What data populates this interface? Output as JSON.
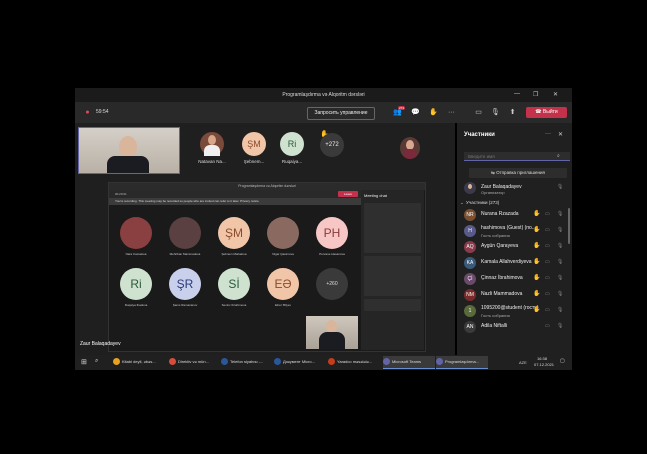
{
  "window": {
    "title": "Programlaşdırma və Alqoritm dərsləri"
  },
  "toolbar": {
    "timer": "59:54",
    "share_label": "Запросить управление",
    "leave_label": "Выйти",
    "people_badge": "273"
  },
  "top_tiles": [
    {
      "initials": "",
      "name": "Natavan Na...",
      "color": "#7a4a3a",
      "photo": true
    },
    {
      "initials": "ŞM",
      "name": "Şebnem...",
      "color": "#f0c5a8",
      "photo": false
    },
    {
      "initials": "Ri",
      "name": "Ruqaiya...",
      "color": "#cfe2d0",
      "photo": false
    },
    {
      "initials": "+272",
      "name": "",
      "color": "#3a3a3a",
      "photo": false
    }
  ],
  "presenter_name": "Zaur Balaqadayev",
  "shared": {
    "title": "Programlaşdırma və Alqoritm dərsləri",
    "banner": "You're recording. This meeting may be recorded so people who are invited can refer to it later. Privacy notice",
    "timer": "00:20:01",
    "leave": "Leave",
    "chat_title": "Meeting chat",
    "tiles": [
      {
        "initials": "",
        "name": "Nara Camalova",
        "color": "#8a4040",
        "photo": true
      },
      {
        "initials": "",
        "name": "Mehriban Mammadova",
        "color": "#5a4040",
        "photo": true
      },
      {
        "initials": "ŞM",
        "name": "Şebnem Mahalova",
        "color": "#f0c5a8",
        "photo": false
      },
      {
        "initials": "",
        "name": "Nigar Qasimova",
        "color": "#8a6a60",
        "photo": true
      },
      {
        "initials": "PH",
        "name": "Pervane Hasanova",
        "color": "#f6c7c5",
        "photo": false
      },
      {
        "initials": "Ri",
        "name": "Ruqaiya Ibadova",
        "color": "#cfe2d0",
        "photo": false
      },
      {
        "initials": "ŞR",
        "name": "Şams Ramazanov",
        "color": "#c8d0ec",
        "photo": false
      },
      {
        "initials": "Sİ",
        "name": "Sevinc Ibrahimova",
        "color": "#cfe2d0",
        "photo": false
      },
      {
        "initials": "EƏ",
        "name": "Elnur Əliyev",
        "color": "#f0c5a8",
        "photo": false
      },
      {
        "initials": "+260",
        "name": "",
        "color": "#3a3a3a",
        "photo": false
      }
    ]
  },
  "panel": {
    "title": "Участники",
    "search_placeholder": "Введите имя",
    "invite_label": "Отправка приглашения",
    "organizer": {
      "name": "Zaur Balaqadayev",
      "role": "Организатор"
    },
    "attendees_header": "Участники (273)",
    "attendees": [
      {
        "name": "Nurana Rzazada",
        "sub": "",
        "initials": "NR",
        "color": "#7a5030",
        "hand": true
      },
      {
        "name": "hashimova (Guest) (по...",
        "sub": "Гость собрания",
        "initials": "H",
        "color": "#5a5a8a",
        "hand": true
      },
      {
        "name": "Aygün Qarayeva",
        "sub": "",
        "initials": "AQ",
        "color": "#8a3a4a",
        "hand": true
      },
      {
        "name": "Kamala Allahverdiyeva",
        "sub": "",
        "initials": "KA",
        "color": "#3a5a7a",
        "hand": true
      },
      {
        "name": "Çinnaz İbrahimova",
        "sub": "",
        "initials": "Çİ",
        "color": "#6a4a6a",
        "hand": true
      },
      {
        "name": "Nazli Mammadova",
        "sub": "",
        "initials": "NM",
        "color": "#7a2a2a",
        "hand": true
      },
      {
        "name": "1095200@student (гость)",
        "sub": "Гость собрания",
        "initials": "1",
        "color": "#5a6a3a",
        "hand": true
      },
      {
        "name": "Adila Niftalli",
        "sub": "",
        "initials": "AN",
        "color": "#3a3a3a",
        "hand": false
      }
    ]
  },
  "taskbar": {
    "items": [
      {
        "label": "Kitabi deyil, əbəs...",
        "color": "#e8a31b"
      },
      {
        "label": "Direktiv və mün...",
        "color": "#d94c3a"
      },
      {
        "label": "Telefon siyahısı -...",
        "color": "#2b579a"
      },
      {
        "label": "Документ Micro...",
        "color": "#2b579a"
      },
      {
        "label": "Yaradıcı məsələlə...",
        "color": "#c43e1c"
      },
      {
        "label": "Microsoft Teams",
        "color": "#6264a7"
      },
      {
        "label": "Programlaşdırma...",
        "color": "#6264a7"
      }
    ],
    "lang": "AZE",
    "time": "16:38",
    "date": "07.12.2021"
  }
}
